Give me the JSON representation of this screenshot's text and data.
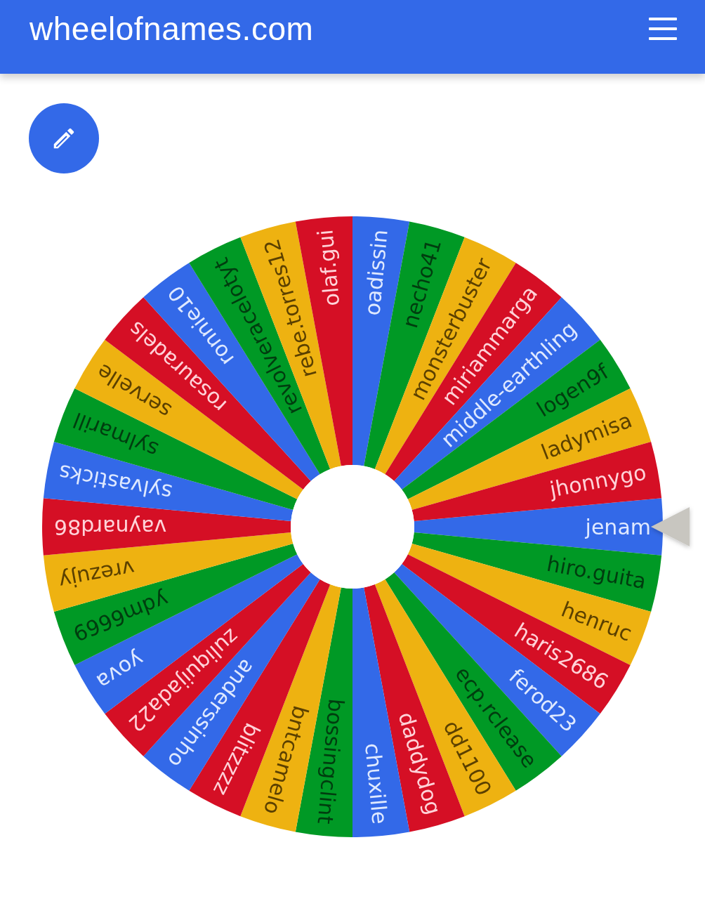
{
  "header": {
    "title": "wheelofnames.com"
  },
  "wheel": {
    "entries": [
      {
        "name": "jenam",
        "color": "#3369e8"
      },
      {
        "name": "hiro.guita",
        "color": "#009925"
      },
      {
        "name": "henruc",
        "color": "#eeb211"
      },
      {
        "name": "haris2686",
        "color": "#d50f25"
      },
      {
        "name": "ferod23",
        "color": "#3369e8"
      },
      {
        "name": "ecp.rclease",
        "color": "#009925"
      },
      {
        "name": "dd1100",
        "color": "#eeb211"
      },
      {
        "name": "daddydog",
        "color": "#d50f25"
      },
      {
        "name": "chuxille",
        "color": "#3369e8"
      },
      {
        "name": "bossingclint",
        "color": "#009925"
      },
      {
        "name": "bntcamelo",
        "color": "#eeb211"
      },
      {
        "name": "blitzzzz",
        "color": "#d50f25"
      },
      {
        "name": "anderssinho",
        "color": "#3369e8"
      },
      {
        "name": "zuliquijada22",
        "color": "#d50f25"
      },
      {
        "name": "yova",
        "color": "#3369e8"
      },
      {
        "name": "ydm6669",
        "color": "#009925"
      },
      {
        "name": "vrezujy",
        "color": "#eeb211"
      },
      {
        "name": "vaynard86",
        "color": "#d50f25"
      },
      {
        "name": "sylvasticks",
        "color": "#3369e8"
      },
      {
        "name": "sylmarill",
        "color": "#009925"
      },
      {
        "name": "servelle",
        "color": "#eeb211"
      },
      {
        "name": "rosauradels",
        "color": "#d50f25"
      },
      {
        "name": "ronnie10",
        "color": "#3369e8"
      },
      {
        "name": "revolveracelotyt",
        "color": "#009925"
      },
      {
        "name": "rebe.torres12",
        "color": "#eeb211"
      },
      {
        "name": "olaf.gui",
        "color": "#d50f25"
      },
      {
        "name": "oadissin",
        "color": "#3369e8"
      },
      {
        "name": "necho41",
        "color": "#009925"
      },
      {
        "name": "monsterbuster",
        "color": "#eeb211"
      },
      {
        "name": "miriammarga",
        "color": "#d50f25"
      },
      {
        "name": "middle-earthling",
        "color": "#3369e8"
      },
      {
        "name": "logen9f",
        "color": "#009925"
      },
      {
        "name": "ladymisa",
        "color": "#eeb211"
      },
      {
        "name": "jhonnygo",
        "color": "#d50f25"
      }
    ]
  }
}
